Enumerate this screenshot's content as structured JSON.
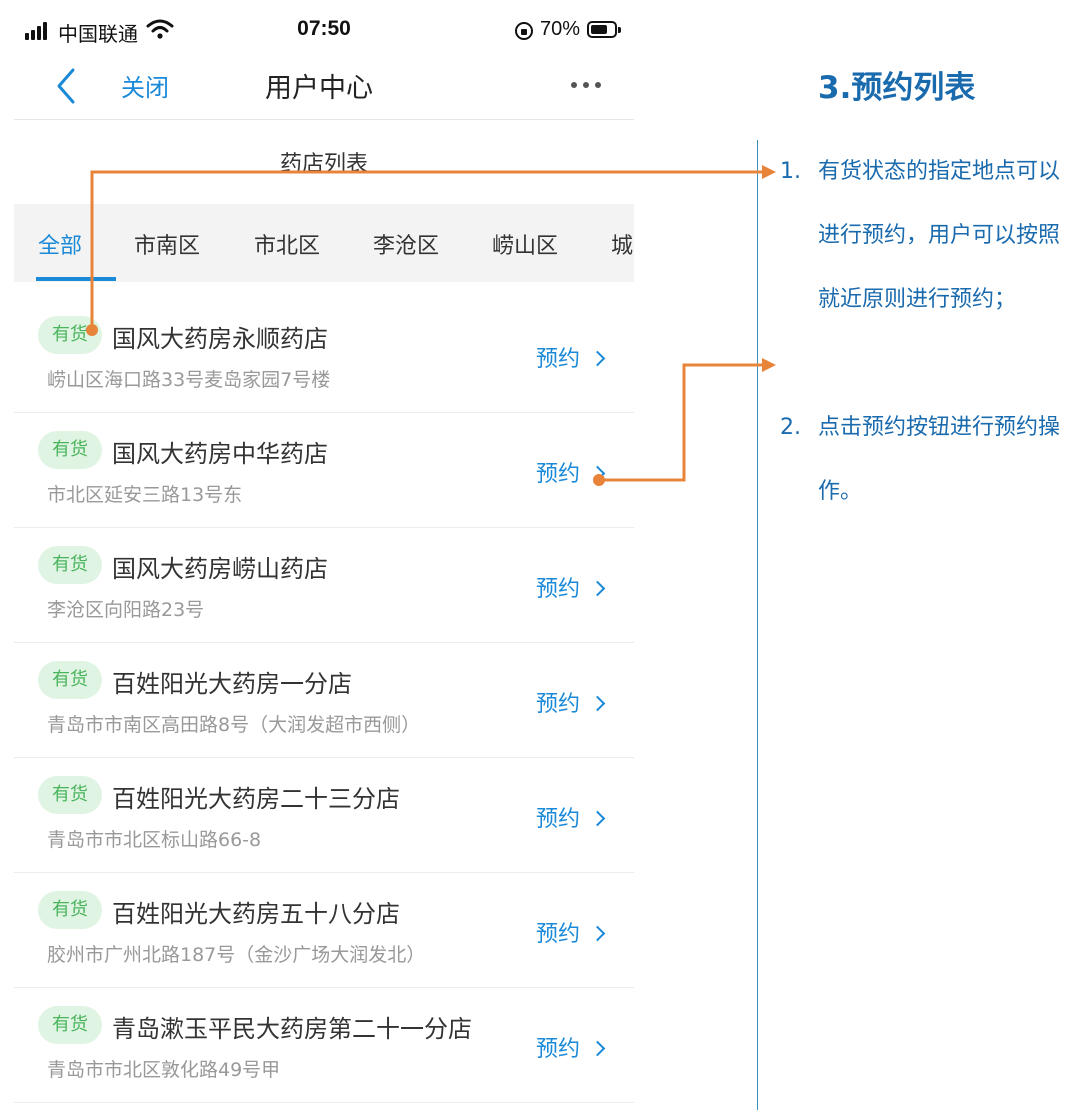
{
  "status_bar": {
    "carrier": "中国联通",
    "time": "07:50",
    "battery": "70%"
  },
  "nav": {
    "close_label": "关闭",
    "title": "用户中心"
  },
  "section_title": "药店列表",
  "tabs": [
    {
      "label": "全部",
      "active": true
    },
    {
      "label": "市南区"
    },
    {
      "label": "市北区"
    },
    {
      "label": "李沧区"
    },
    {
      "label": "崂山区"
    },
    {
      "label": "城"
    }
  ],
  "stores": [
    {
      "badge": "有货",
      "name": "国风大药房永顺药店",
      "address": "崂山区海口路33号麦岛家园7号楼",
      "action": "预约"
    },
    {
      "badge": "有货",
      "name": "国风大药房中华药店",
      "address": "市北区延安三路13号东",
      "action": "预约"
    },
    {
      "badge": "有货",
      "name": "国风大药房崂山药店",
      "address": "李沧区向阳路23号",
      "action": "预约"
    },
    {
      "badge": "有货",
      "name": "百姓阳光大药房一分店",
      "address": "青岛市市南区高田路8号（大润发超市西侧）",
      "action": "预约"
    },
    {
      "badge": "有货",
      "name": "百姓阳光大药房二十三分店",
      "address": "青岛市市北区标山路66-8",
      "action": "预约"
    },
    {
      "badge": "有货",
      "name": "百姓阳光大药房五十八分店",
      "address": "胶州市广州北路187号（金沙广场大润发北）",
      "action": "预约"
    },
    {
      "badge": "有货",
      "name": "青岛漱玉平民大药房第二十一分店",
      "address": "青岛市市北区敦化路49号甲",
      "action": "预约"
    }
  ],
  "annotation": {
    "title": "3.预约列表",
    "items": [
      {
        "num": "1.",
        "text": "有货状态的指定地点可以进行预约，用户可以按照就近原则进行预约；"
      },
      {
        "num": "2.",
        "text": "点击预约按钮进行预约操作。"
      }
    ],
    "accent_color": "#1a6aae",
    "connector_color": "#e8843a"
  }
}
